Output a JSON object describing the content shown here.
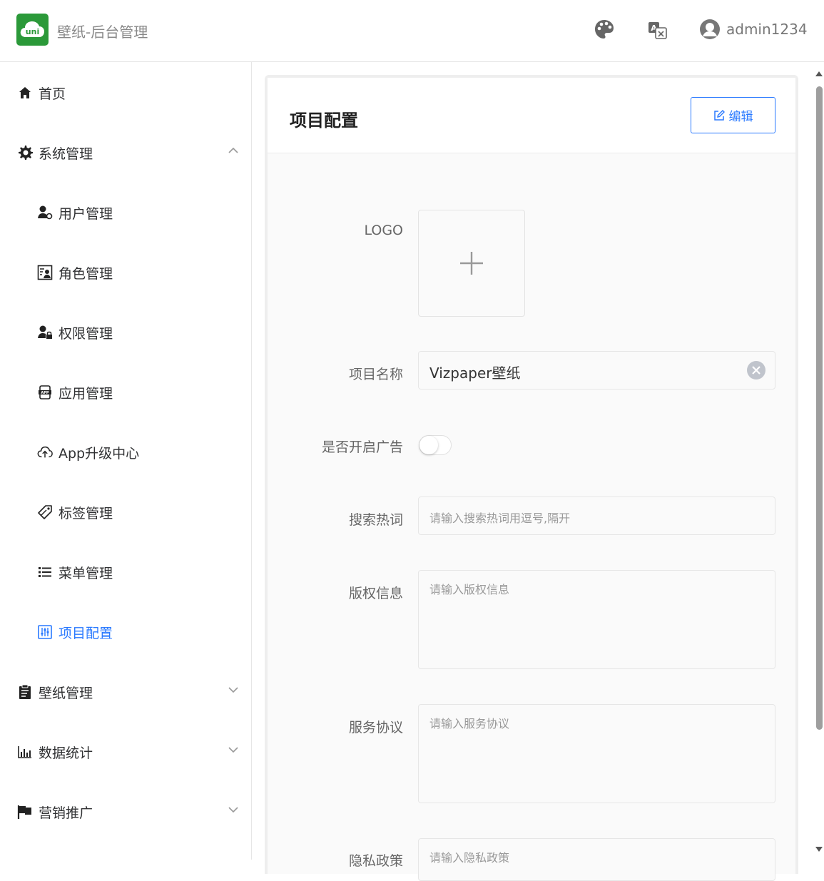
{
  "header": {
    "logo_text": "uni",
    "app_title": "壁纸-后台管理",
    "user_name": "admin1234"
  },
  "colors": {
    "brand": "#2b9939",
    "accent": "#2979ff"
  },
  "sidebar": {
    "items": [
      {
        "label": "首页",
        "icon": "home-icon"
      },
      {
        "label": "系统管理",
        "icon": "gear-icon",
        "expanded": true
      },
      {
        "label": "用户管理",
        "icon": "user-manage-icon"
      },
      {
        "label": "角色管理",
        "icon": "role-icon"
      },
      {
        "label": "权限管理",
        "icon": "permission-icon"
      },
      {
        "label": "应用管理",
        "icon": "app-icon"
      },
      {
        "label": "App升级中心",
        "icon": "cloud-upload-icon"
      },
      {
        "label": "标签管理",
        "icon": "tag-icon"
      },
      {
        "label": "菜单管理",
        "icon": "list-icon"
      },
      {
        "label": "项目配置",
        "icon": "config-icon",
        "active": true
      },
      {
        "label": "壁纸管理",
        "icon": "clipboard-icon"
      },
      {
        "label": "数据统计",
        "icon": "bar-chart-icon"
      },
      {
        "label": "营销推广",
        "icon": "flag-icon"
      }
    ]
  },
  "main": {
    "title": "项目配置",
    "edit_label": "编辑",
    "form": {
      "logo_label": "LOGO",
      "name_label": "项目名称",
      "name_value": "Vizpaper壁纸",
      "ad_label": "是否开启广告",
      "ad_enabled": false,
      "keywords_label": "搜索热词",
      "keywords_placeholder": "请输入搜索热词用逗号,隔开",
      "copyright_label": "版权信息",
      "copyright_placeholder": "请输入版权信息",
      "service_label": "服务协议",
      "service_placeholder": "请输入服务协议",
      "privacy_label": "隐私政策",
      "privacy_placeholder": "请输入隐私政策"
    }
  }
}
